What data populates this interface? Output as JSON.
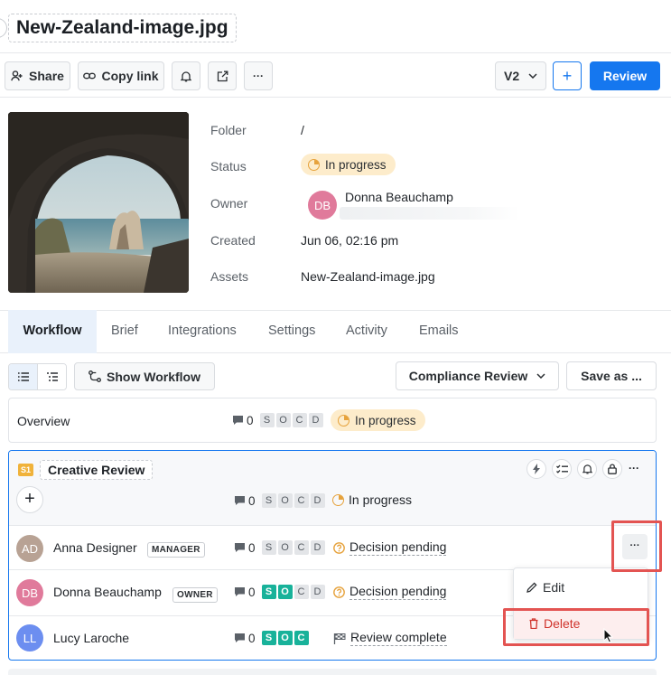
{
  "header": {
    "title": "New-Zealand-image.jpg"
  },
  "toolbar": {
    "share_label": "Share",
    "copy_link_label": "Copy link",
    "bell_icon": "bell-icon",
    "export_icon": "export-icon",
    "more_label": "···",
    "version_label": "V2",
    "add_label": "+",
    "review_label": "Review"
  },
  "meta": {
    "folder_label": "Folder",
    "folder_value": "/",
    "status_label": "Status",
    "status_value": "In progress",
    "owner_label": "Owner",
    "owner_name": "Donna Beauchamp",
    "owner_initials": "DB",
    "created_label": "Created",
    "created_value": "Jun 06, 02:16 pm",
    "assets_label": "Assets",
    "assets_value": "New-Zealand-image.jpg"
  },
  "tabs": [
    {
      "label": "Workflow"
    },
    {
      "label": "Brief"
    },
    {
      "label": "Integrations"
    },
    {
      "label": "Settings"
    },
    {
      "label": "Activity"
    },
    {
      "label": "Emails"
    }
  ],
  "workflow_bar": {
    "show_workflow_label": "Show Workflow",
    "template_label": "Compliance Review",
    "save_as_label": "Save as ..."
  },
  "overview": {
    "label": "Overview",
    "count": "0",
    "status": "In progress"
  },
  "stage": {
    "badge": "S1",
    "name": "Creative Review",
    "more_label": "···",
    "add_label": "+",
    "count": "0",
    "status": "In progress",
    "reviewers": [
      {
        "initials": "AD",
        "name": "Anna Designer",
        "role": "MANAGER",
        "count": "0",
        "status": "Decision pending",
        "color": "#b8a294"
      },
      {
        "initials": "DB",
        "name": "Donna Beauchamp",
        "role": "OWNER",
        "count": "0",
        "status": "Decision pending",
        "color": "#e07a9b"
      },
      {
        "initials": "LL",
        "name": "Lucy Laroche",
        "role": "",
        "count": "0",
        "status": "Review complete",
        "color": "#6c8ef0"
      }
    ]
  },
  "row_more_label": "···",
  "context_menu": {
    "edit_label": "Edit",
    "delete_label": "Delete"
  },
  "chips": [
    "S",
    "O",
    "C",
    "D"
  ],
  "colors": {
    "accent": "#1577ef",
    "pending": "#e6a23c",
    "done": "#18b29a",
    "danger": "#d0342c",
    "highlight": "#e35452"
  }
}
